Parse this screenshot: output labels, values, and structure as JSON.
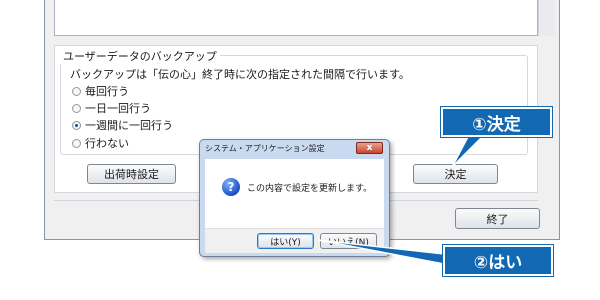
{
  "backup": {
    "title": "ユーザーデータのバックアップ",
    "description": "バックアップは「伝の心」終了時に次の指定された間隔で行います。",
    "options": [
      "毎回行う",
      "一日一回行う",
      "一週間に一回行う",
      "行わない"
    ],
    "selected_option": "一週間に一回行う"
  },
  "buttons": {
    "factory_reset": "出荷時設定",
    "confirm": "決定",
    "exit": "終了"
  },
  "dialog": {
    "title": "システム・アプリケーション設定",
    "close_glyph": "x",
    "icon_glyph": "?",
    "message": "この内容で設定を更新します。",
    "yes": "はい(Y)",
    "no": "いいえ(N)"
  },
  "callouts": {
    "step1": "①決定",
    "step2": "②はい"
  },
  "colors": {
    "callout": "#1368b3",
    "dialog_frame": "#c9daf0",
    "close_button": "#c7462e",
    "focus_button": "#2a78d3"
  },
  "icons": {
    "dialog_icon": "question-icon",
    "dialog_close": "close-icon"
  }
}
